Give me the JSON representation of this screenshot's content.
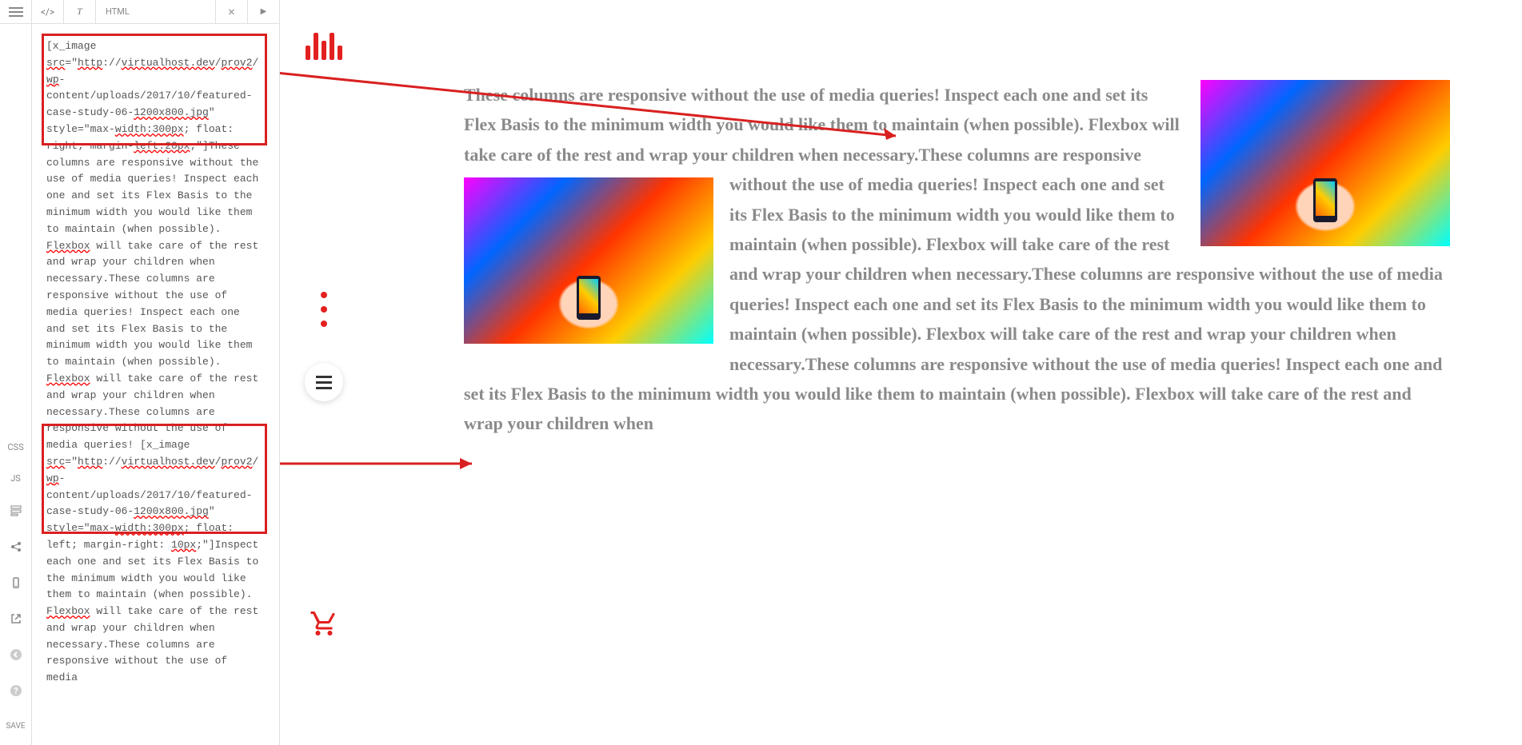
{
  "tabs": {
    "code": "</>",
    "text": "T",
    "label": "HTML",
    "close": "×",
    "play": "▶"
  },
  "leftRail": {
    "css": "CSS",
    "js": "JS",
    "save": "SAVE"
  },
  "code": {
    "line1_a": "[x_image ",
    "line1_b": "src",
    "line1_c": "=\"",
    "line1_d": "http",
    "line1_e": "://",
    "line1_f": "virtualhost.dev",
    "line1_g": "/",
    "line1_h": "prov2",
    "line1_i": "/",
    "line1_j": "w",
    "line2_a": "p",
    "line2_b": "-content/uploads/2017/10/featured-case-study-06-",
    "line2_c": "1200x800.jpg",
    "line2_d": "\" style=\"max-",
    "line2_e": "width:300px",
    "line2_f": "; float: right; margin-",
    "line2_g": "left:20px",
    "line2_h": ";\"]These columns are responsive without the use of media queries! Inspect each one and set its Flex Basis to the minimum width you would like them to maintain (when possible). ",
    "line2_i": "Flexbox",
    "line2_j": " will take care of the rest and wrap your children when necessary.These columns are responsive without the use of media queries! Inspect each one and set its Flex Basis to the minimum width you would like them to maintain (when possible). ",
    "line2_k": "Flexbox",
    "line2_l": " will take care of the rest and wrap your children when necessary.These columns are responsive without the use of media queries! [x_image ",
    "line3_a": "src",
    "line3_b": "=\"",
    "line3_c": "http",
    "line3_d": "://",
    "line3_e": "virtualhost.dev",
    "line3_f": "/",
    "line3_g": "prov2",
    "line3_h": "/",
    "line3_i": "w",
    "line4_a": "p",
    "line4_b": "-content/uploads/2017/10/featured-case-study-06-",
    "line4_c": "1200x800.jpg",
    "line4_d": "\" style=\"max-",
    "line4_e": "width:300px",
    "line4_f": "; float: left; margin-right: ",
    "line4_g": "10px",
    "line4_h": ";\"]Inspect each one and set its Flex Basis to the minimum width you would like them to maintain (when possible). ",
    "line4_i": "Flexbox",
    "line4_j": " will take care of the rest and wrap your children when necessary.These columns are responsive without the use of media"
  },
  "preview": {
    "text": "These columns are responsive without the use of media queries! Inspect each one and set its Flex Basis to the minimum width you would like them to maintain (when possible). Flexbox will take care of the rest and wrap your children when necessary.These columns are responsive without the use of media queries! Inspect each one and set its Flex Basis to the minimum width you would like them to maintain (when possible). Flexbox will take care of the rest and wrap your children when necessary.These columns are responsive without the use of media queries! Inspect each one and set its Flex Basis to the minimum width you would like them to maintain (when possible). Flexbox will take care of the rest and wrap your children when necessary.These columns are responsive without the use of media queries! Inspect each one and set its Flex Basis to the minimum width you would like them to maintain (when possible). Flexbox will take care of the rest and wrap your children when"
  }
}
